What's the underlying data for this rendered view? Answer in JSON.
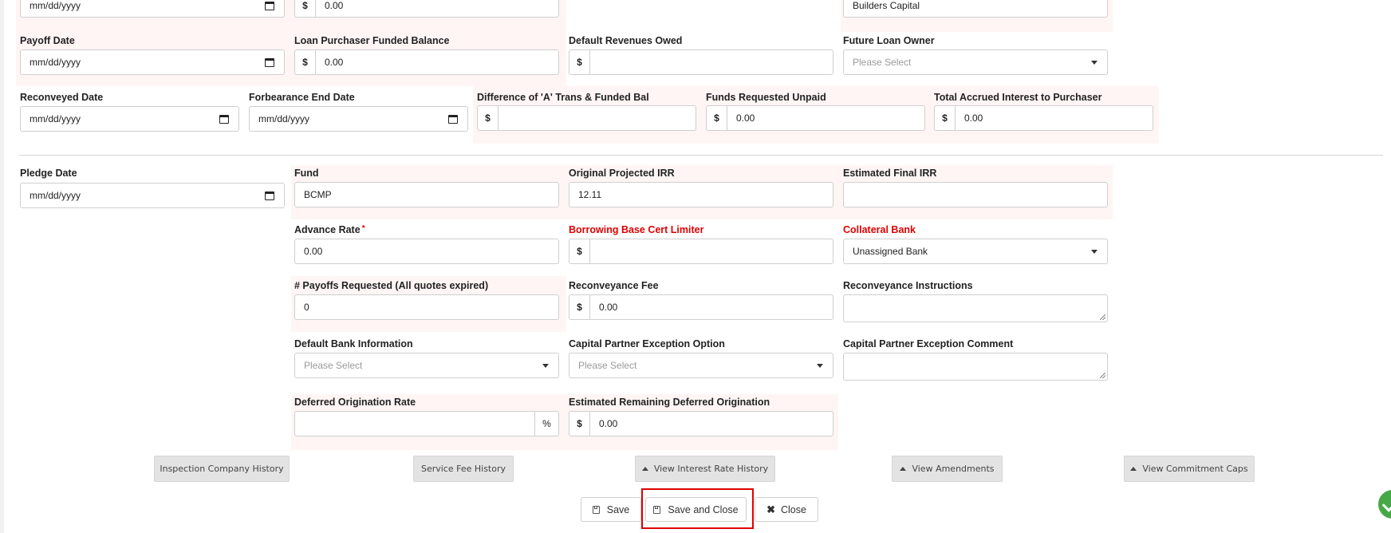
{
  "fields": {
    "top_date": {
      "value": "mm/dd/yyyy"
    },
    "top_balance": {
      "prefix": "$",
      "value": "0.00"
    },
    "top_owner": {
      "value": "Builders Capital"
    },
    "payoff_date": {
      "label": "Payoff Date",
      "value": "mm/dd/yyyy"
    },
    "loan_purchaser_funded_balance": {
      "label": "Loan Purchaser Funded Balance",
      "prefix": "$",
      "value": "0.00"
    },
    "default_revenues_owed": {
      "label": "Default Revenues Owed",
      "prefix": "$",
      "value": ""
    },
    "future_loan_owner": {
      "label": "Future Loan Owner",
      "placeholder": "Please Select"
    },
    "reconveyed_date": {
      "label": "Reconveyed Date",
      "value": "mm/dd/yyyy"
    },
    "forbearance_end_date": {
      "label": "Forbearance End Date",
      "value": "mm/dd/yyyy"
    },
    "difference_a_trans": {
      "label": "Difference of 'A' Trans & Funded Bal",
      "prefix": "$",
      "value": ""
    },
    "funds_requested_unpaid": {
      "label": "Funds Requested Unpaid",
      "prefix": "$",
      "value": "0.00"
    },
    "total_accrued_interest": {
      "label": "Total Accrued Interest to Purchaser",
      "prefix": "$",
      "value": "0.00"
    },
    "pledge_date": {
      "label": "Pledge Date",
      "value": "mm/dd/yyyy"
    },
    "fund": {
      "label": "Fund",
      "value": "BCMP"
    },
    "original_projected_irr": {
      "label": "Original Projected IRR",
      "value": "12.11"
    },
    "estimated_final_irr": {
      "label": "Estimated Final IRR",
      "value": ""
    },
    "advance_rate": {
      "label": "Advance Rate",
      "required_mark": "*",
      "value": "0.00"
    },
    "borrowing_base_cert_limiter": {
      "label": "Borrowing Base Cert Limiter",
      "prefix": "$",
      "value": ""
    },
    "collateral_bank": {
      "label": "Collateral Bank",
      "value": "Unassigned Bank"
    },
    "payoffs_requested": {
      "label": "# Payoffs Requested (All quotes expired)",
      "value": "0"
    },
    "reconveyance_fee": {
      "label": "Reconveyance Fee",
      "prefix": "$",
      "value": "0.00"
    },
    "reconveyance_instructions": {
      "label": "Reconveyance Instructions",
      "value": ""
    },
    "default_bank_information": {
      "label": "Default Bank Information",
      "placeholder": "Please Select"
    },
    "capital_partner_exception_option": {
      "label": "Capital Partner Exception Option",
      "placeholder": "Please Select"
    },
    "capital_partner_exception_comment": {
      "label": "Capital Partner Exception Comment",
      "value": ""
    },
    "deferred_origination_rate": {
      "label": "Deferred Origination Rate",
      "suffix": "%",
      "value": ""
    },
    "estimated_remaining_deferred_origination": {
      "label": "Estimated Remaining Deferred Origination",
      "prefix": "$",
      "value": "0.00"
    }
  },
  "history_buttons": {
    "inspection_company_history": "Inspection Company History",
    "service_fee_history": "Service Fee History",
    "view_interest_rate_history": "View Interest Rate History",
    "view_amendments": "View Amendments",
    "view_commitment_caps": "View Commitment Caps"
  },
  "actions": {
    "save": "Save",
    "save_and_close": "Save and Close",
    "close": "Close"
  },
  "colors": {
    "required_label": "#e00000",
    "highlight_border": "#e00000",
    "shaded_group": "#fff5f5",
    "fab": "#46a846"
  }
}
